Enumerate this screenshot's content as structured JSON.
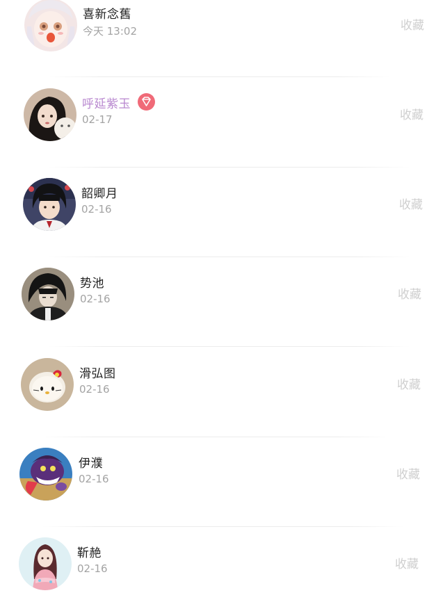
{
  "favorite_label": "收藏",
  "badge_icon": "diamond-icon",
  "colors": {
    "vip_name": "#b887cf",
    "vip_badge": "#f06a78",
    "name": "#222222",
    "date": "#a3a3a3",
    "favorite": "#cfcfcf"
  },
  "users": [
    {
      "name": "喜新念舊",
      "date": "今天 13:02",
      "vip": false
    },
    {
      "name": "呼延紫玉",
      "date": "02-17",
      "vip": true
    },
    {
      "name": "韶卿月",
      "date": "02-16",
      "vip": false
    },
    {
      "name": "势池",
      "date": "02-16",
      "vip": false
    },
    {
      "name": "滑弘图",
      "date": "02-16",
      "vip": false
    },
    {
      "name": "伊濮",
      "date": "02-16",
      "vip": false
    },
    {
      "name": "靳赩",
      "date": "02-16",
      "vip": false
    }
  ]
}
